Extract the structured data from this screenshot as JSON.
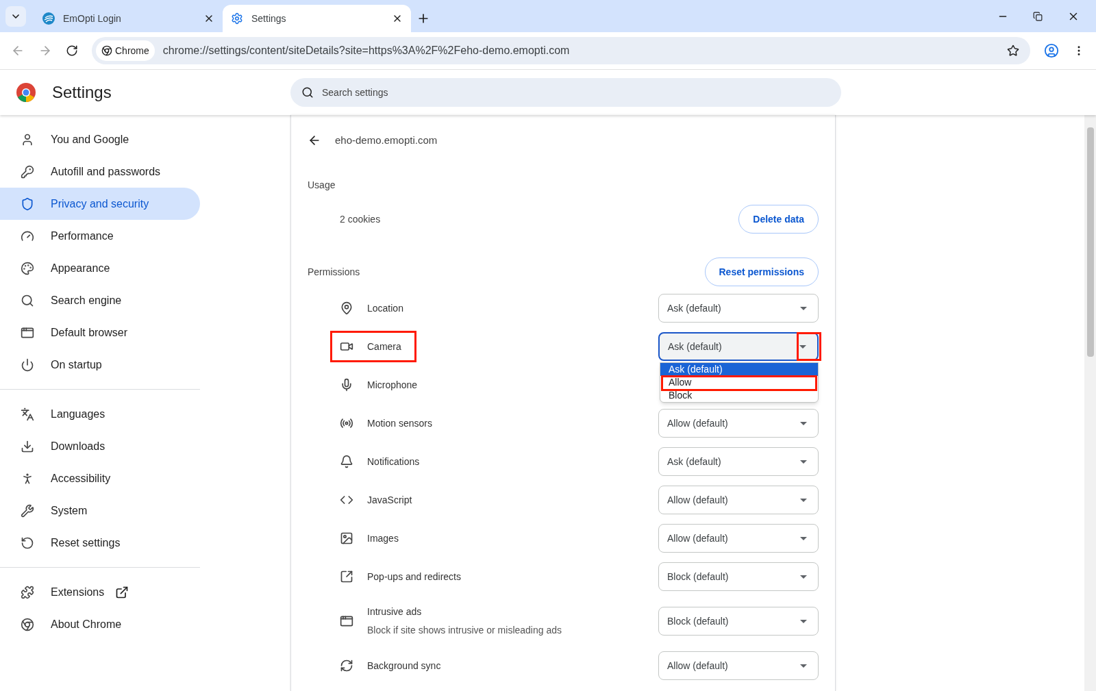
{
  "tabs": [
    {
      "title": "EmOpti Login",
      "selected": false
    },
    {
      "title": "Settings",
      "selected": true
    }
  ],
  "toolbar": {
    "chip": "Chrome",
    "url": "chrome://settings/content/siteDetails?site=https%3A%2F%2Feho-demo.emopti.com"
  },
  "header": {
    "title": "Settings",
    "search_placeholder": "Search settings"
  },
  "sidebar": {
    "groups": [
      [
        {
          "label": "You and Google",
          "selected": false
        },
        {
          "label": "Autofill and passwords",
          "selected": false
        },
        {
          "label": "Privacy and security",
          "selected": true
        },
        {
          "label": "Performance",
          "selected": false
        },
        {
          "label": "Appearance",
          "selected": false
        },
        {
          "label": "Search engine",
          "selected": false
        },
        {
          "label": "Default browser",
          "selected": false
        },
        {
          "label": "On startup",
          "selected": false
        }
      ],
      [
        {
          "label": "Languages",
          "selected": false
        },
        {
          "label": "Downloads",
          "selected": false
        },
        {
          "label": "Accessibility",
          "selected": false
        },
        {
          "label": "System",
          "selected": false
        },
        {
          "label": "Reset settings",
          "selected": false
        }
      ],
      [
        {
          "label": "Extensions",
          "selected": false
        },
        {
          "label": "About Chrome",
          "selected": false
        }
      ]
    ]
  },
  "site": {
    "name": "eho-demo.emopti.com",
    "usage": {
      "heading": "Usage",
      "cookies": "2 cookies",
      "button": "Delete data"
    },
    "permissions": {
      "heading": "Permissions",
      "button": "Reset permissions",
      "items": [
        {
          "name": "Location",
          "value": "Ask (default)",
          "highlighted": false,
          "open": false
        },
        {
          "name": "Camera",
          "value": "Ask (default)",
          "highlighted": true,
          "open": true,
          "options": [
            {
              "label": "Ask (default)",
              "selected": true,
              "highlighted": false
            },
            {
              "label": "Allow",
              "selected": false,
              "highlighted": true
            },
            {
              "label": "Block",
              "selected": false,
              "highlighted": false
            }
          ]
        },
        {
          "name": "Microphone",
          "highlighted": false
        },
        {
          "name": "Motion sensors",
          "value": "Allow (default)",
          "highlighted": false,
          "open": false
        },
        {
          "name": "Notifications",
          "value": "Ask (default)",
          "highlighted": false,
          "open": false
        },
        {
          "name": "JavaScript",
          "value": "Allow (default)",
          "highlighted": false,
          "open": false
        },
        {
          "name": "Images",
          "value": "Allow (default)",
          "highlighted": false,
          "open": false
        },
        {
          "name": "Pop-ups and redirects",
          "value": "Block (default)",
          "highlighted": false,
          "open": false
        },
        {
          "name": "Intrusive ads",
          "description": "Block if site shows intrusive or misleading ads",
          "value": "Block (default)",
          "highlighted": false,
          "open": false
        },
        {
          "name": "Background sync",
          "value": "Allow (default)",
          "highlighted": false,
          "open": false
        }
      ]
    }
  }
}
